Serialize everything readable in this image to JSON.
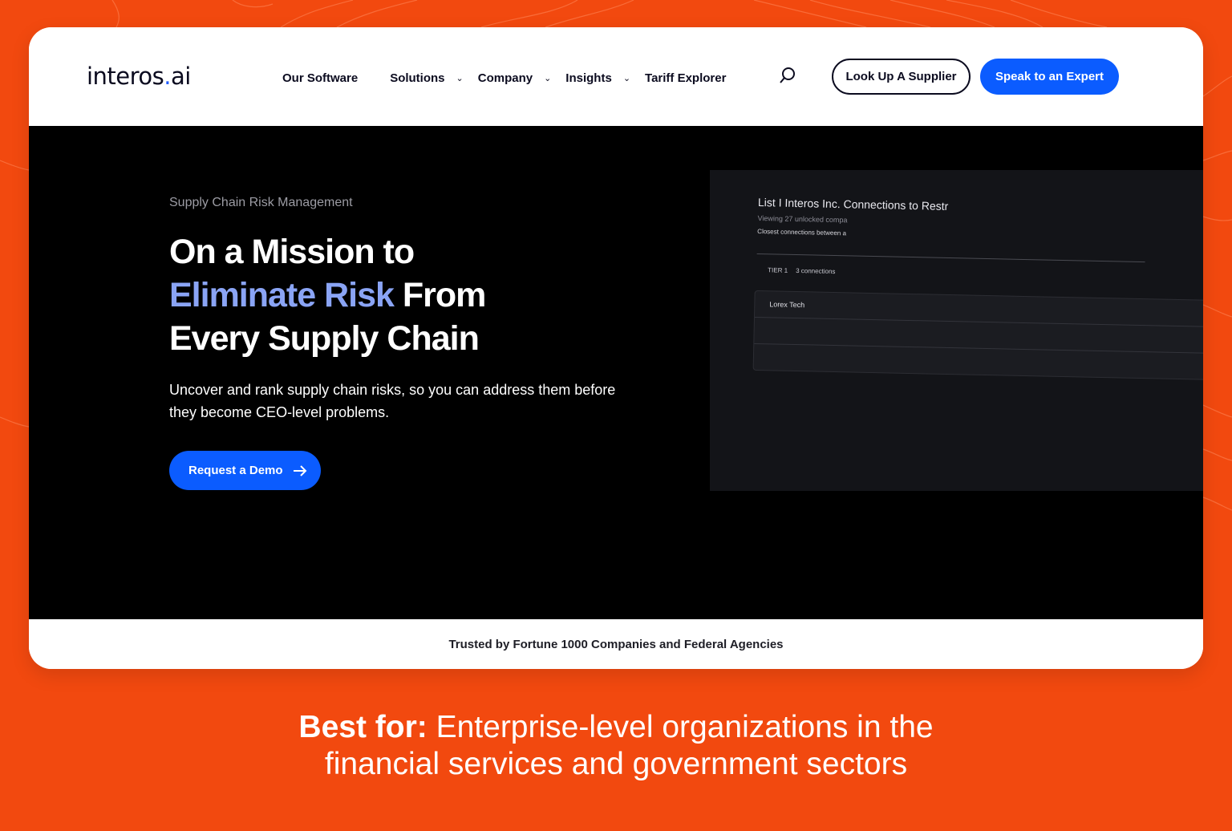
{
  "colors": {
    "background": "#f2490f",
    "brand_blue": "#0b5cff",
    "headline_accent": "#8aa4f5",
    "hero_bg": "#000000"
  },
  "header": {
    "logo_text": "interos",
    "logo_dot": ".",
    "logo_suffix": "ai",
    "nav": [
      {
        "label": "Our Software",
        "has_dropdown": false
      },
      {
        "label": "Solutions",
        "has_dropdown": true
      },
      {
        "label": "Company",
        "has_dropdown": true
      },
      {
        "label": "Insights",
        "has_dropdown": true
      },
      {
        "label": "Tariff Explorer",
        "has_dropdown": false
      }
    ],
    "search_icon": "search-icon",
    "lookup_button": "Look Up A Supplier",
    "expert_button": "Speak to an Expert"
  },
  "hero": {
    "eyebrow": "Supply Chain Risk Management",
    "headline_line1": "On a Mission to",
    "headline_accent": "Eliminate Risk",
    "headline_after_accent": " From",
    "headline_line3": "Every Supply Chain",
    "subtext": "Uncover and rank supply chain risks, so you can address them before they become CEO-level problems.",
    "cta_label": "Request a Demo",
    "cta_icon": "arrow-right-icon"
  },
  "app_preview": {
    "title": "List I Interos Inc. Connections to Restr",
    "viewing": "Viewing 27 unlocked compa",
    "closest": "Closest connections between a",
    "tier_label": "TIER 1",
    "tier_count": "3 connections",
    "rows": [
      "Lorex Tech",
      "",
      ""
    ]
  },
  "trust_bar": {
    "text": "Trusted by Fortune 1000 Companies and Federal Agencies"
  },
  "caption": {
    "lead": "Best for:",
    "line1_rest": " Enterprise-level organizations in the",
    "line2": "financial services and government sectors"
  }
}
